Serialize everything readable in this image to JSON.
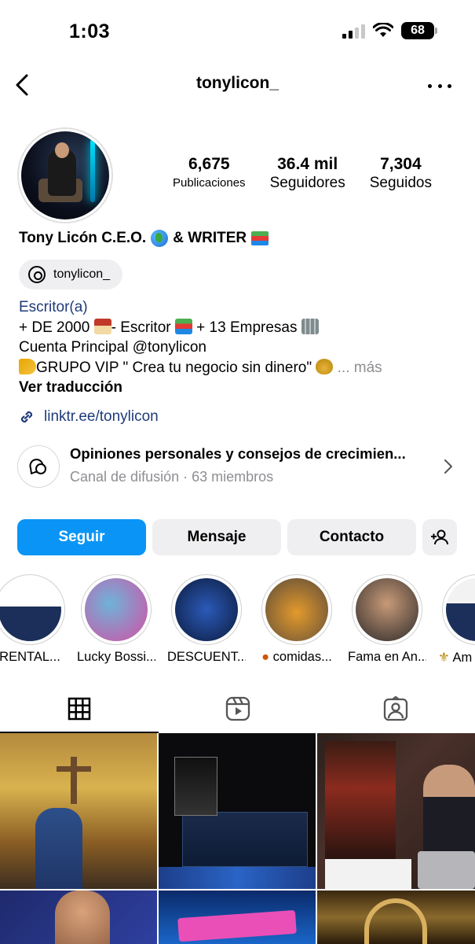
{
  "status": {
    "time": "1:03",
    "battery": "68"
  },
  "header": {
    "username": "tonylicon_"
  },
  "stats": {
    "posts": {
      "value": "6,675",
      "label": "Publicaciones"
    },
    "followers": {
      "value": "36.4 mil",
      "label": "Seguidores"
    },
    "following": {
      "value": "7,304",
      "label": "Seguidos"
    }
  },
  "profile": {
    "name": "Tony Licón C.E.O.",
    "name_suffix": "& WRITER",
    "threads_handle": "tonylicon_",
    "category": "Escritor(a)",
    "bio_line1_a": "+ DE 2000",
    "bio_line1_b": "- Escritor",
    "bio_line1_c": "+ 13 Empresas",
    "bio_line2": "Cuenta Principal @tonylicon",
    "bio_line3": "GRUPO VIP \" Crea tu negocio sin dinero\"",
    "bio_more": "... más",
    "translate": "Ver traducción",
    "link": "linktr.ee/tonylicon"
  },
  "channel": {
    "title": "Opiniones personales y consejos de crecimien...",
    "subtitle": "Canal de difusión · 63 miembros"
  },
  "buttons": {
    "follow": "Seguir",
    "message": "Mensaje",
    "contact": "Contacto"
  },
  "highlights": [
    {
      "label": "RENTAL...",
      "colors": [
        "#ffffff",
        "#1b2f5a"
      ]
    },
    {
      "label": "Lucky Bossi...",
      "colors": [
        "#6fb3d9",
        "#d34fa4"
      ]
    },
    {
      "label": "DESCUENT...",
      "colors": [
        "#0c1b3d",
        "#2b5ab8"
      ]
    },
    {
      "label": "comidas...",
      "colors": [
        "#5a4a3a",
        "#e39a2c"
      ]
    },
    {
      "label": "Fama en An...",
      "colors": [
        "#2d2a2a",
        "#c89a78"
      ]
    },
    {
      "label": "Am",
      "colors": [
        "#f2f2f2",
        "#1b2f5a"
      ]
    }
  ]
}
